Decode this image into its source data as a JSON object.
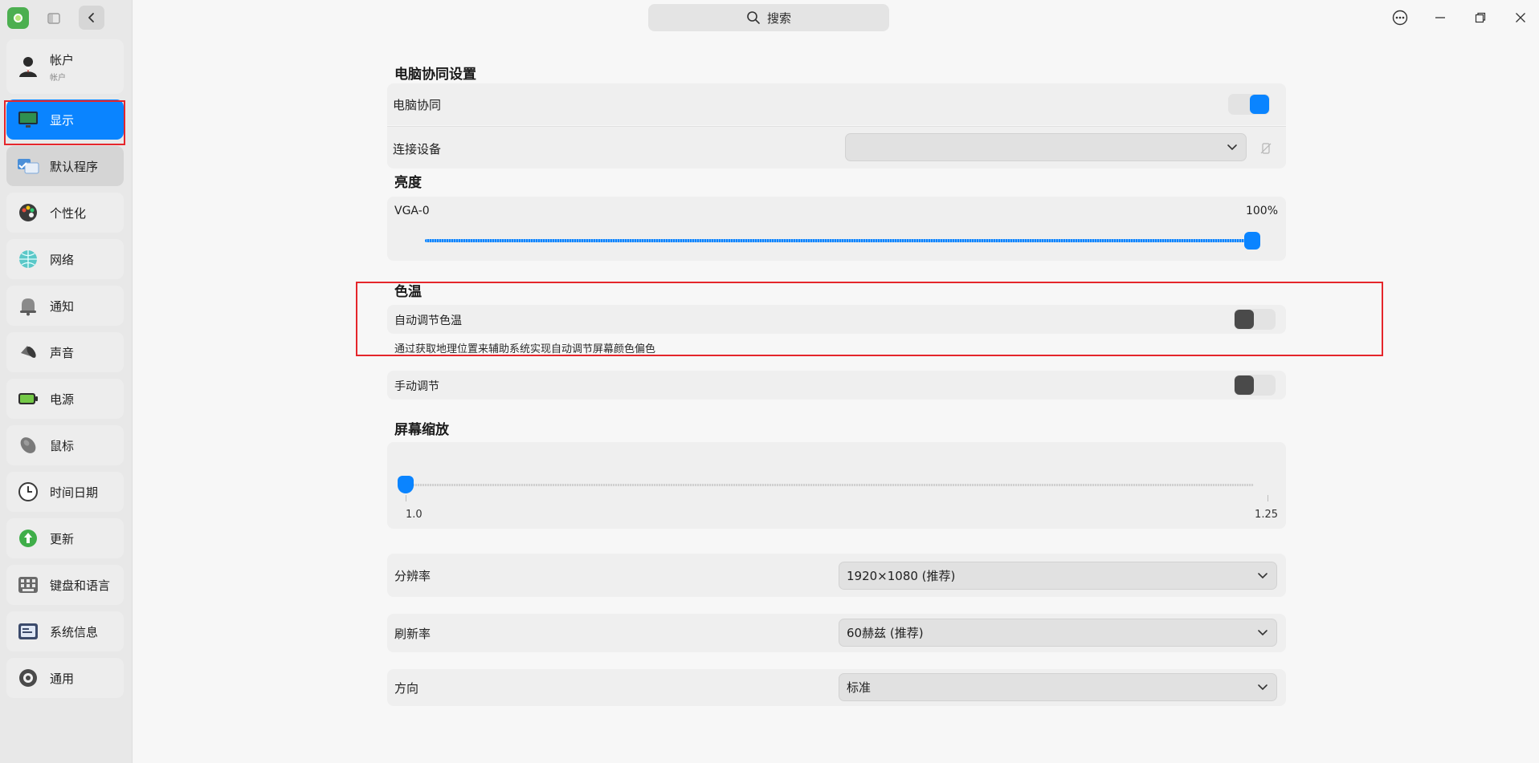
{
  "search": {
    "placeholder": "搜索"
  },
  "sidebar": {
    "items": [
      {
        "label": "帐户",
        "sub": "帐户",
        "icon": "account-icon"
      },
      {
        "label": "显示",
        "icon": "monitor-icon"
      },
      {
        "label": "默认程序",
        "icon": "default-apps-icon"
      },
      {
        "label": "个性化",
        "icon": "palette-icon"
      },
      {
        "label": "网络",
        "icon": "globe-icon"
      },
      {
        "label": "通知",
        "icon": "bell-icon"
      },
      {
        "label": "声音",
        "icon": "speaker-icon"
      },
      {
        "label": "电源",
        "icon": "battery-icon"
      },
      {
        "label": "鼠标",
        "icon": "mouse-icon"
      },
      {
        "label": "时间日期",
        "icon": "clock-icon"
      },
      {
        "label": "更新",
        "icon": "update-icon"
      },
      {
        "label": "键盘和语言",
        "icon": "keyboard-icon"
      },
      {
        "label": "系统信息",
        "icon": "system-info-icon"
      },
      {
        "label": "通用",
        "icon": "general-icon"
      }
    ]
  },
  "main": {
    "collab": {
      "title": "电脑协同设置",
      "toggle_label": "电脑协同",
      "toggle_on": true,
      "device_label": "连接设备",
      "device_value": ""
    },
    "brightness": {
      "title": "亮度",
      "monitor": "VGA-0",
      "percent": "100%",
      "level": 1.0
    },
    "color_temp": {
      "title": "色温",
      "auto_label": "自动调节色温",
      "auto_on": false,
      "auto_desc": "通过获取地理位置来辅助系统实现自动调节屏幕颜色偏色",
      "manual_label": "手动调节",
      "manual_on": false
    },
    "scaling": {
      "title": "屏幕缩放",
      "min_label": "1.0",
      "max_label": "1.25",
      "value": 1.0
    },
    "resolution": {
      "label": "分辨率",
      "value": "1920×1080 (推荐)"
    },
    "refresh": {
      "label": "刷新率",
      "value": "60赫兹 (推荐)"
    },
    "orientation": {
      "label": "方向",
      "value": "标准"
    }
  },
  "colors": {
    "accent": "#0a84ff",
    "highlight_box": "#e5262b"
  }
}
